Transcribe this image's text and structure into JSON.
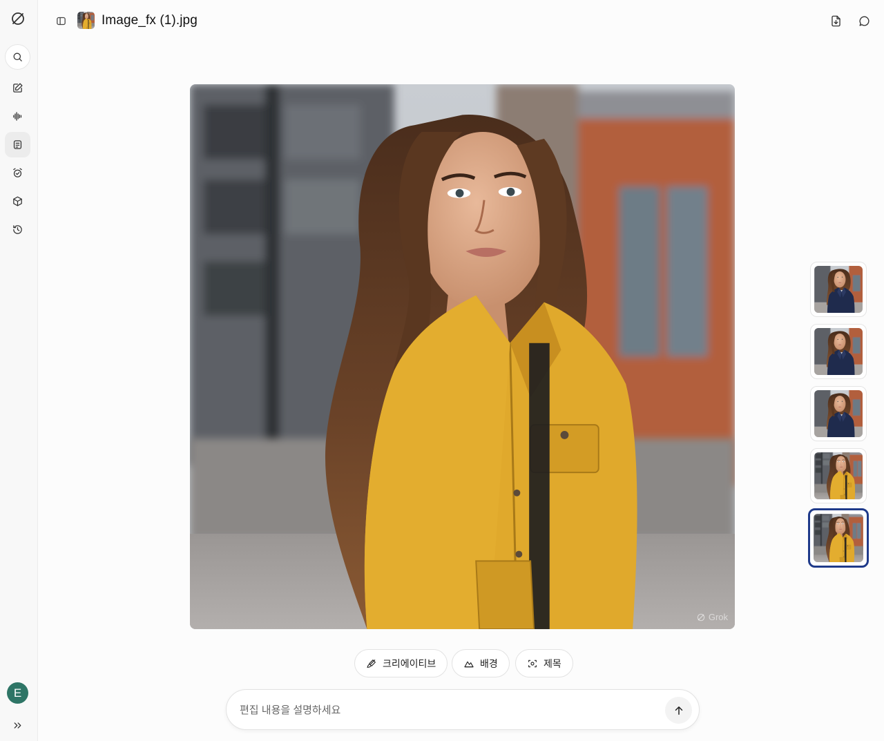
{
  "header": {
    "file_title": "Image_fx (1).jpg"
  },
  "rail": {
    "items": [
      "logo-icon",
      "search-icon",
      "edit-icon",
      "voice-icon",
      "notes-icon",
      "alarm-icon",
      "box-icon",
      "history-icon"
    ],
    "avatar_letter": "E",
    "expand_icon": "chevrons-right-icon"
  },
  "main_image": {
    "watermark": "Grok"
  },
  "thumbnails": [
    {
      "outfit": "navy",
      "selected": false
    },
    {
      "outfit": "navy",
      "selected": false
    },
    {
      "outfit": "navy",
      "selected": false
    },
    {
      "outfit": "yellow",
      "selected": false
    },
    {
      "outfit": "yellow",
      "selected": true
    }
  ],
  "actions": {
    "creative_label": "크리에이티브",
    "background_label": "배경",
    "subject_label": "제목"
  },
  "prompt": {
    "placeholder": "편집 내용을 설명하세요",
    "value": ""
  },
  "colors": {
    "accent": "#1f3a8a",
    "avatar": "#2e7566",
    "jacket": "#e0a92c"
  }
}
